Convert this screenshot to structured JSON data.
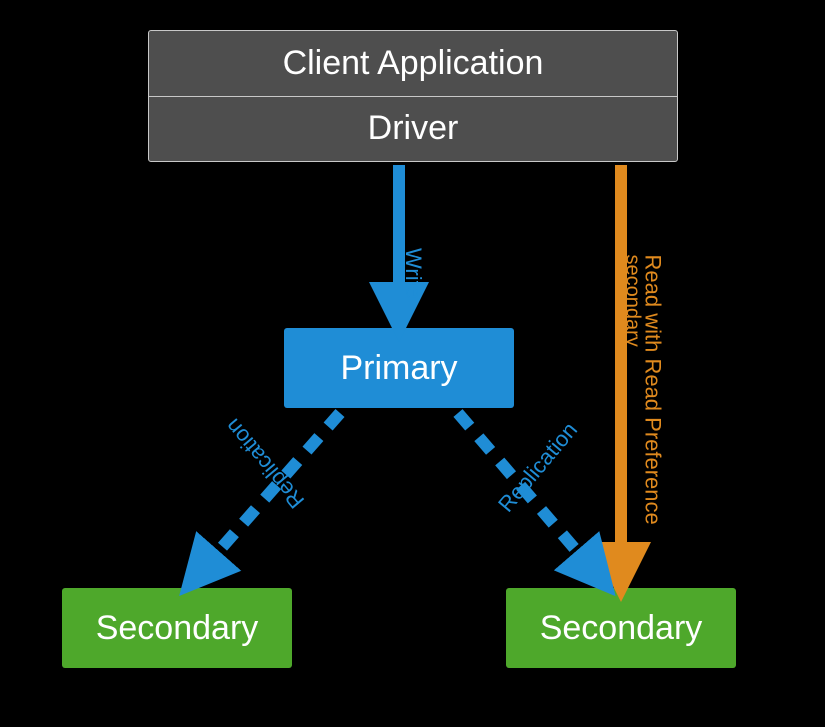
{
  "nodes": {
    "client_app": "Client Application",
    "driver": "Driver",
    "primary": "Primary",
    "secondary_left": "Secondary",
    "secondary_right": "Secondary"
  },
  "edges": {
    "write": "Write",
    "read_line1": "Read with Read Preference",
    "read_line2": "secondary",
    "replication_left": "Replication",
    "replication_right": "Replication"
  },
  "colors": {
    "primary_box": "#1f8dd6",
    "secondary_box": "#4ea82b",
    "client_box": "#4e4e4e",
    "write_arrow": "#1f8dd6",
    "replication_arrow": "#1f8dd6",
    "read_arrow": "#e08a1e"
  }
}
